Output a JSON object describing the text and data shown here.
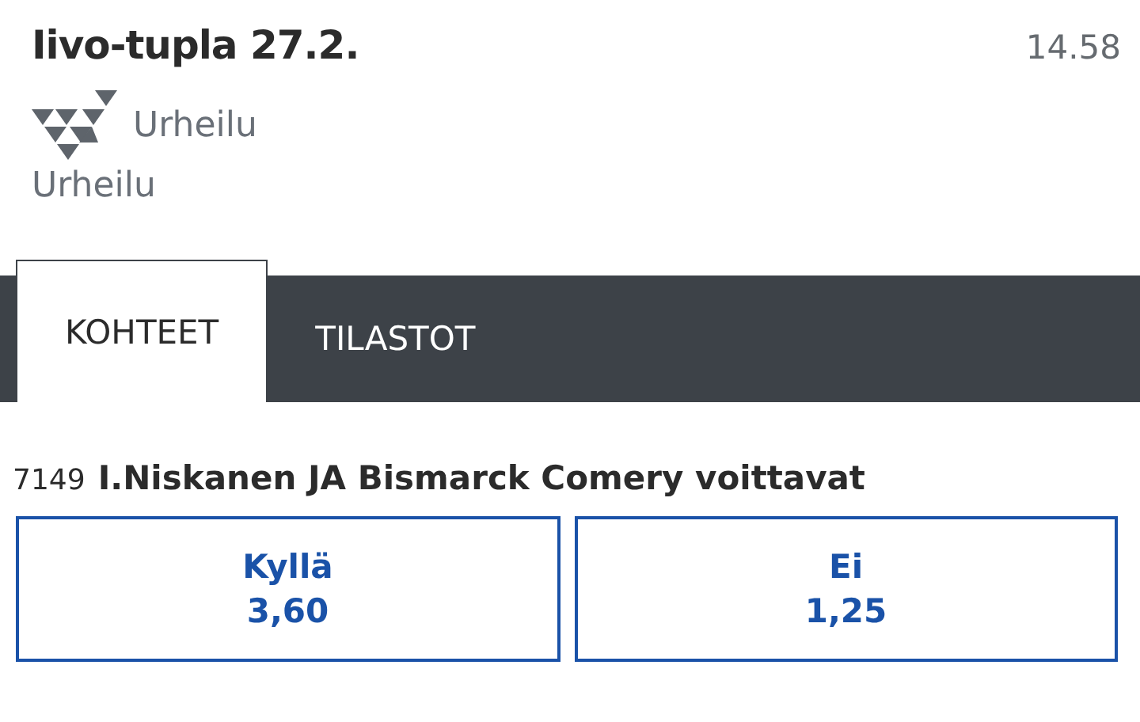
{
  "header": {
    "title": "Iivo-tupla 27.2.",
    "time": "14.58",
    "logo_text": "Urheilu",
    "category": "Urheilu"
  },
  "tabs": [
    {
      "label": "KOHTEET",
      "selected": true
    },
    {
      "label": "TILASTOT",
      "selected": false
    }
  ],
  "market": {
    "number": "7149",
    "title": "I.Niskanen JA Bismarck Comery voittavat",
    "outcomes": [
      {
        "label": "Kyllä",
        "odds": "3,60"
      },
      {
        "label": "Ei",
        "odds": "1,25"
      }
    ]
  }
}
